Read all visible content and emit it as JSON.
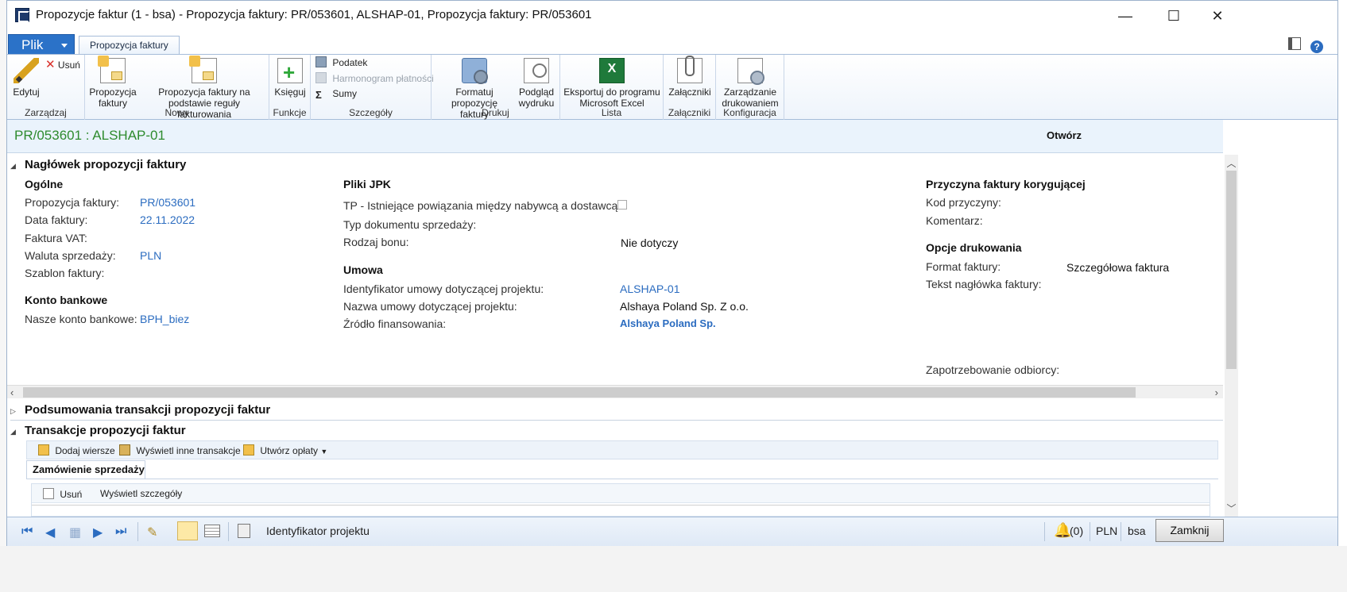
{
  "window": {
    "title": "Propozycje faktur (1 - bsa) - Propozycja faktury: PR/053601, ALSHAP-01, Propozycja faktury: PR/053601",
    "minimize": "—",
    "maximize": "☐",
    "close": "✕"
  },
  "ribbon_tabs": {
    "file": "Plik",
    "active": "Propozycja faktury"
  },
  "ribbon": {
    "manage": {
      "edit": "Edytuj",
      "delete": "Usuń",
      "title": "Zarządzaj"
    },
    "new": {
      "proposal_line1": "Propozycja",
      "proposal_line2": "faktury",
      "rule_line1": "Propozycja faktury na",
      "rule_line2": "podstawie reguły fakturowania",
      "title": "Nowy"
    },
    "functions": {
      "post": "Księguj",
      "title": "Funkcje"
    },
    "details": {
      "tax": "Podatek",
      "schedule": "Harmonogram płatności",
      "totals": "Sumy",
      "title": "Szczegóły"
    },
    "print": {
      "format_line1": "Formatuj",
      "format_line2": "propozycję faktury",
      "preview_line1": "Podgląd",
      "preview_line2": "wydruku",
      "title": "Drukuj"
    },
    "list": {
      "excel_line1": "Eksportuj do programu",
      "excel_line2": "Microsoft Excel",
      "title": "Lista"
    },
    "attachments": {
      "attachments": "Załączniki",
      "title": "Załączniki"
    },
    "config": {
      "print_mgmt_line1": "Zarządzanie",
      "print_mgmt_line2": "drukowaniem",
      "title": "Konfiguracja"
    }
  },
  "header": {
    "record_title": "PR/053601 : ALSHAP-01",
    "open_label": "Otwórz"
  },
  "section_header": {
    "title": "Nagłówek propozycji faktury",
    "general": {
      "title": "Ogólne",
      "proposal_label": "Propozycja faktury:",
      "proposal_value": "PR/053601",
      "date_label": "Data faktury:",
      "date_value": "22.11.2022",
      "vat_label": "Faktura VAT:",
      "currency_label": "Waluta sprzedaży:",
      "currency_value": "PLN",
      "template_label": "Szablon faktury:"
    },
    "bank": {
      "title": "Konto bankowe",
      "account_label": "Nasze konto bankowe:",
      "account_value": "BPH_biez"
    },
    "jpk": {
      "title": "Pliki JPK",
      "tp_label": "TP - Istniejące powiązania między nabywcą a dostawcą:",
      "doc_type_label": "Typ dokumentu sprzedaży:",
      "voucher_label": "Rodzaj bonu:",
      "voucher_value": "Nie dotyczy"
    },
    "contract": {
      "title": "Umowa",
      "id_label": "Identyfikator umowy dotyczącej projektu:",
      "id_value": "ALSHAP-01",
      "name_label": "Nazwa umowy dotyczącej projektu:",
      "name_value": "Alshaya Poland Sp. Z o.o.",
      "funding_label": "Źródło finansowania:",
      "funding_value": "Alshaya Poland Sp."
    },
    "correction": {
      "title": "Przyczyna faktury korygującej",
      "code_label": "Kod przyczyny:",
      "comment_label": "Komentarz:"
    },
    "print_options": {
      "title": "Opcje drukowania",
      "format_label": "Format faktury:",
      "format_value": "Szczegółowa faktura",
      "header_text_label": "Tekst nagłówka faktury:",
      "requisition_label": "Zapotrzebowanie odbiorcy:"
    }
  },
  "section_summary": {
    "title": "Podsumowania transakcji propozycji faktur"
  },
  "section_transactions": {
    "title": "Transakcje propozycji faktur",
    "add_lines": "Dodaj wiersze",
    "show_other": "Wyświetl inne transakcje",
    "create_fees": "Utwórz opłaty",
    "subtab": "Zamówienie sprzedaży",
    "grid_delete": "Usuń",
    "grid_details": "Wyświetl szczegóły"
  },
  "statusbar": {
    "field_name": "Identyfikator projektu",
    "notifications": "(0)",
    "currency": "PLN",
    "company": "bsa",
    "close_button": "Zamknij"
  },
  "colors": {
    "accent": "#2b72c8",
    "record_title": "#2e8b2e",
    "link": "#2b6cc0"
  }
}
